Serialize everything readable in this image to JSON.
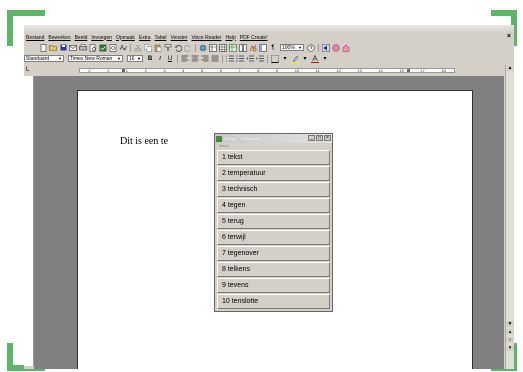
{
  "menubar": {
    "items": [
      "Bestand",
      "Bewerken",
      "Beeld",
      "Invoegen",
      "Opmaak",
      "Extra",
      "Tabel",
      "Venster",
      "Voice Reader",
      "Help",
      "PDF Create!"
    ],
    "close_glyph": "×"
  },
  "toolbar1": {
    "zoom": "100%",
    "icons": [
      "new-doc-icon",
      "open-icon",
      "save-icon",
      "email-icon",
      "print-icon",
      "print-preview-icon",
      "spellcheck-icon",
      "cut-icon",
      "copy-icon",
      "paste-icon",
      "format-painter-icon",
      "undo-icon",
      "redo-icon",
      "hyperlink-icon",
      "tables-borders-icon",
      "insert-table-icon",
      "insert-excel-icon",
      "columns-icon",
      "drawing-icon",
      "document-map-icon",
      "show-formatting-icon",
      "help-icon"
    ]
  },
  "toolbar2": {
    "style": "Standaard",
    "font": "Times New Roman",
    "size": "16",
    "bold": "B",
    "italic": "I",
    "underline": "U"
  },
  "ruler": {
    "numbers": [
      "2",
      "1",
      "1",
      "2",
      "3",
      "4",
      "5",
      "6",
      "7",
      "8",
      "9",
      "10",
      "11",
      "12",
      "13",
      "14",
      "15",
      "17",
      "18"
    ]
  },
  "document": {
    "text": "Dit is een te"
  },
  "popup": {
    "title": "Skippy - Trefwoorden",
    "menu_label": "Menu",
    "items": [
      "1 tekst",
      "2 temperatuur",
      "3 technisch",
      "4 tegen",
      "5 terug",
      "6 terwijl",
      "7 tegenover",
      "8 telkens",
      "9 tevens",
      "10 tenslotte"
    ]
  },
  "colors": {
    "accent": "#5fb567",
    "chrome": "#d4d0c8",
    "workspace": "#808080"
  }
}
